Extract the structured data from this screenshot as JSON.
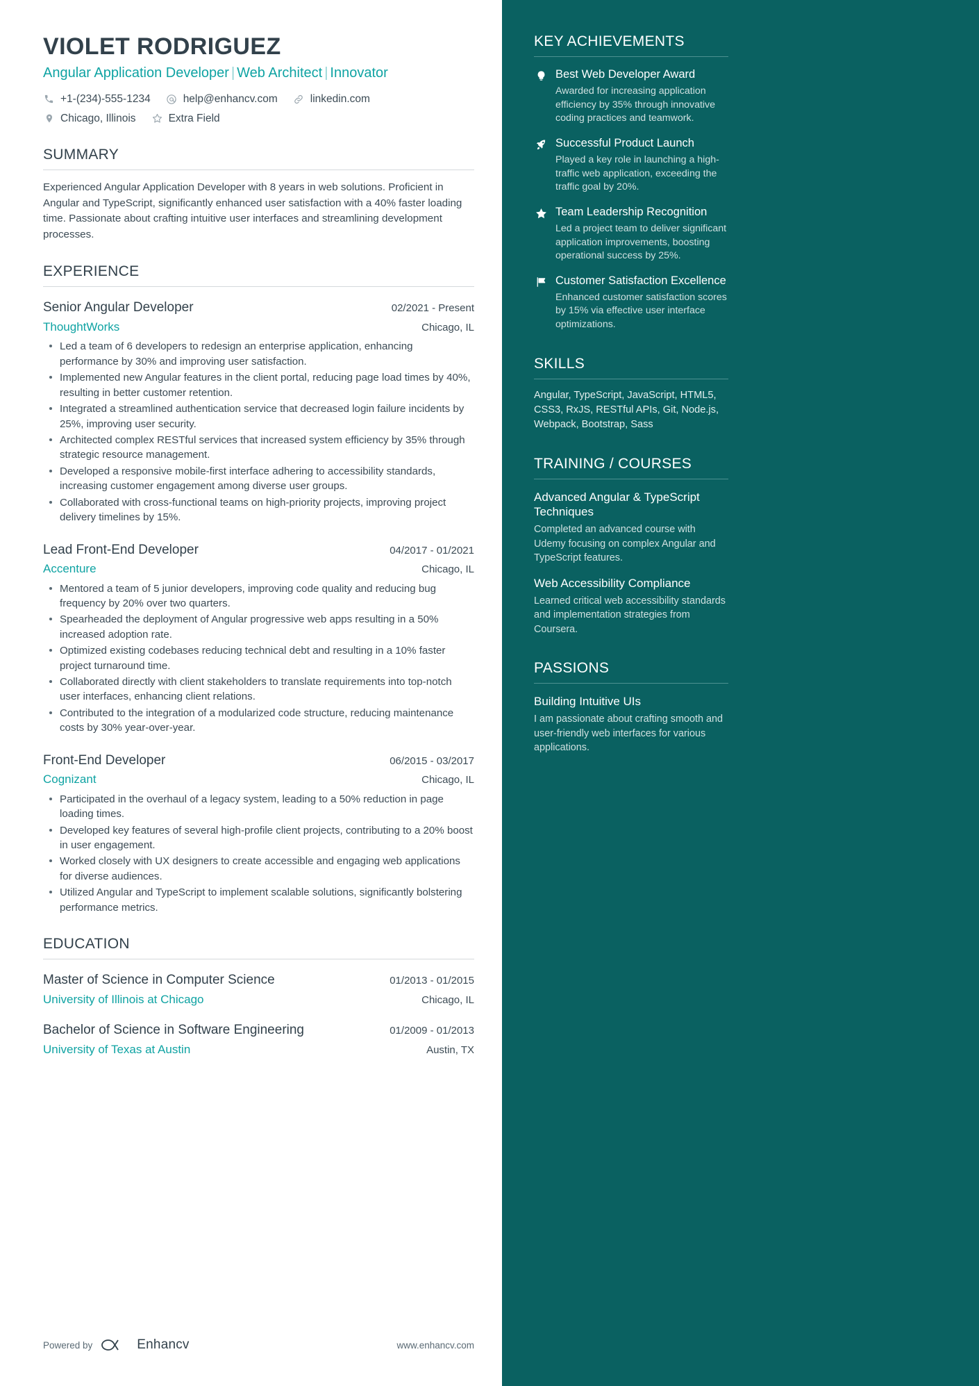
{
  "colors": {
    "accent_teal": "#0fa3a3",
    "sidebar_bg": "#0a6161",
    "ink": "#32414b",
    "body": "#3c4b55",
    "sidebar_muted": "#cfe0e0"
  },
  "header": {
    "name": "VIOLET RODRIGUEZ",
    "headline_parts": [
      "Angular Application Developer",
      "Web Architect",
      "Innovator"
    ],
    "headline": "Angular Application Developer | Web Architect | Innovator",
    "contacts_row1": [
      {
        "icon": "phone-icon",
        "text": "+1-(234)-555-1234"
      },
      {
        "icon": "email-icon",
        "text": "help@enhancv.com"
      },
      {
        "icon": "link-icon",
        "text": "linkedin.com"
      }
    ],
    "contacts_row2": [
      {
        "icon": "location-pin-icon",
        "text": "Chicago, Illinois"
      },
      {
        "icon": "star-icon",
        "text": "Extra Field"
      }
    ]
  },
  "summary": {
    "title": "SUMMARY",
    "text": "Experienced Angular Application Developer with 8 years in web solutions. Proficient in Angular and TypeScript, significantly enhanced user satisfaction with a 40% faster loading time. Passionate about crafting intuitive user interfaces and streamlining development processes."
  },
  "experience": {
    "title": "EXPERIENCE",
    "jobs": [
      {
        "title": "Senior Angular Developer",
        "dates": "02/2021 - Present",
        "company": "ThoughtWorks",
        "location": "Chicago, IL",
        "bullets": [
          "Led a team of 6 developers to redesign an enterprise application, enhancing performance by 30% and improving user satisfaction.",
          "Implemented new Angular features in the client portal, reducing page load times by 40%, resulting in better customer retention.",
          "Integrated a streamlined authentication service that decreased login failure incidents by 25%, improving user security.",
          "Architected complex RESTful services that increased system efficiency by 35% through strategic resource management.",
          "Developed a responsive mobile-first interface adhering to accessibility standards, increasing customer engagement among diverse user groups.",
          "Collaborated with cross-functional teams on high-priority projects, improving project delivery timelines by 15%."
        ]
      },
      {
        "title": "Lead Front-End Developer",
        "dates": "04/2017 - 01/2021",
        "company": "Accenture",
        "location": "Chicago, IL",
        "bullets": [
          "Mentored a team of 5 junior developers, improving code quality and reducing bug frequency by 20% over two quarters.",
          "Spearheaded the deployment of Angular progressive web apps resulting in a 50% increased adoption rate.",
          "Optimized existing codebases reducing technical debt and resulting in a 10% faster project turnaround time.",
          "Collaborated directly with client stakeholders to translate requirements into top-notch user interfaces, enhancing client relations.",
          "Contributed to the integration of a modularized code structure, reducing maintenance costs by 30% year-over-year."
        ]
      },
      {
        "title": "Front-End Developer",
        "dates": "06/2015 - 03/2017",
        "company": "Cognizant",
        "location": "Chicago, IL",
        "bullets": [
          "Participated in the overhaul of a legacy system, leading to a 50% reduction in page loading times.",
          "Developed key features of several high-profile client projects, contributing to a 20% boost in user engagement.",
          "Worked closely with UX designers to create accessible and engaging web applications for diverse audiences.",
          "Utilized Angular and TypeScript to implement scalable solutions, significantly bolstering performance metrics."
        ]
      }
    ]
  },
  "education": {
    "title": "EDUCATION",
    "items": [
      {
        "degree": "Master of Science in Computer Science",
        "dates": "01/2013 - 01/2015",
        "school": "University of Illinois at Chicago",
        "location": "Chicago, IL"
      },
      {
        "degree": "Bachelor of Science in Software Engineering",
        "dates": "01/2009 - 01/2013",
        "school": "University of Texas at Austin",
        "location": "Austin, TX"
      }
    ]
  },
  "footer": {
    "powered_by": "Powered by",
    "brand": "Enhancv",
    "url": "www.enhancv.com"
  },
  "sidebar": {
    "achievements": {
      "title": "KEY ACHIEVEMENTS",
      "items": [
        {
          "icon": "lightbulb-icon",
          "title": "Best Web Developer Award",
          "desc": "Awarded for increasing application efficiency by 35% through innovative coding practices and teamwork."
        },
        {
          "icon": "rocket-icon",
          "title": "Successful Product Launch",
          "desc": "Played a key role in launching a high-traffic web application, exceeding the traffic goal by 20%."
        },
        {
          "icon": "star-filled-icon",
          "title": "Team Leadership Recognition",
          "desc": "Led a project team to deliver significant application improvements, boosting operational success by 25%."
        },
        {
          "icon": "flag-icon",
          "title": "Customer Satisfaction Excellence",
          "desc": "Enhanced customer satisfaction scores by 15% via effective user interface optimizations."
        }
      ]
    },
    "skills": {
      "title": "SKILLS",
      "text": "Angular, TypeScript, JavaScript, HTML5, CSS3, RxJS, RESTful APIs, Git, Node.js, Webpack, Bootstrap, Sass"
    },
    "training": {
      "title": "TRAINING / COURSES",
      "items": [
        {
          "title": "Advanced Angular & TypeScript Techniques",
          "desc": "Completed an advanced course with Udemy focusing on complex Angular and TypeScript features."
        },
        {
          "title": "Web Accessibility Compliance",
          "desc": "Learned critical web accessibility standards and implementation strategies from Coursera."
        }
      ]
    },
    "passions": {
      "title": "PASSIONS",
      "items": [
        {
          "title": "Building Intuitive UIs",
          "desc": "I am passionate about crafting smooth and user-friendly web interfaces for various applications."
        }
      ]
    }
  }
}
